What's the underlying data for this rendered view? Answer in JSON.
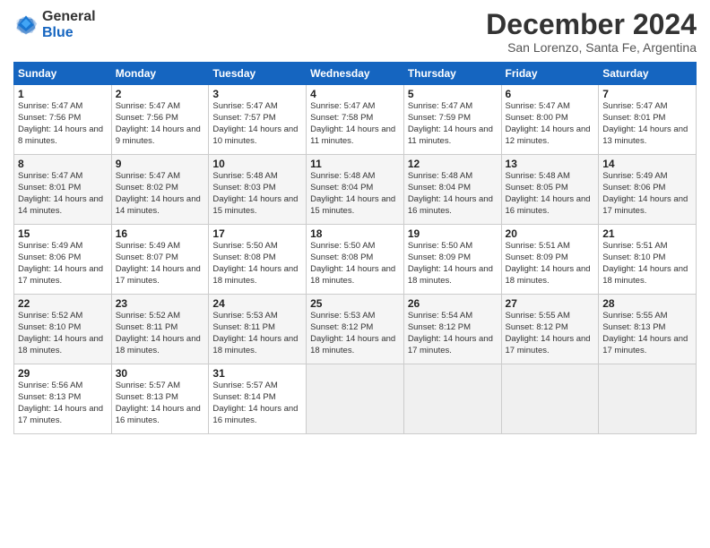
{
  "header": {
    "logo_general": "General",
    "logo_blue": "Blue",
    "month_title": "December 2024",
    "location": "San Lorenzo, Santa Fe, Argentina"
  },
  "days_of_week": [
    "Sunday",
    "Monday",
    "Tuesday",
    "Wednesday",
    "Thursday",
    "Friday",
    "Saturday"
  ],
  "weeks": [
    [
      {
        "day": 1,
        "sunrise": "5:47 AM",
        "sunset": "7:56 PM",
        "daylight": "14 hours and 8 minutes."
      },
      {
        "day": 2,
        "sunrise": "5:47 AM",
        "sunset": "7:56 PM",
        "daylight": "14 hours and 9 minutes."
      },
      {
        "day": 3,
        "sunrise": "5:47 AM",
        "sunset": "7:57 PM",
        "daylight": "14 hours and 10 minutes."
      },
      {
        "day": 4,
        "sunrise": "5:47 AM",
        "sunset": "7:58 PM",
        "daylight": "14 hours and 11 minutes."
      },
      {
        "day": 5,
        "sunrise": "5:47 AM",
        "sunset": "7:59 PM",
        "daylight": "14 hours and 11 minutes."
      },
      {
        "day": 6,
        "sunrise": "5:47 AM",
        "sunset": "8:00 PM",
        "daylight": "14 hours and 12 minutes."
      },
      {
        "day": 7,
        "sunrise": "5:47 AM",
        "sunset": "8:01 PM",
        "daylight": "14 hours and 13 minutes."
      }
    ],
    [
      {
        "day": 8,
        "sunrise": "5:47 AM",
        "sunset": "8:01 PM",
        "daylight": "14 hours and 14 minutes."
      },
      {
        "day": 9,
        "sunrise": "5:47 AM",
        "sunset": "8:02 PM",
        "daylight": "14 hours and 14 minutes."
      },
      {
        "day": 10,
        "sunrise": "5:48 AM",
        "sunset": "8:03 PM",
        "daylight": "14 hours and 15 minutes."
      },
      {
        "day": 11,
        "sunrise": "5:48 AM",
        "sunset": "8:04 PM",
        "daylight": "14 hours and 15 minutes."
      },
      {
        "day": 12,
        "sunrise": "5:48 AM",
        "sunset": "8:04 PM",
        "daylight": "14 hours and 16 minutes."
      },
      {
        "day": 13,
        "sunrise": "5:48 AM",
        "sunset": "8:05 PM",
        "daylight": "14 hours and 16 minutes."
      },
      {
        "day": 14,
        "sunrise": "5:49 AM",
        "sunset": "8:06 PM",
        "daylight": "14 hours and 17 minutes."
      }
    ],
    [
      {
        "day": 15,
        "sunrise": "5:49 AM",
        "sunset": "8:06 PM",
        "daylight": "14 hours and 17 minutes."
      },
      {
        "day": 16,
        "sunrise": "5:49 AM",
        "sunset": "8:07 PM",
        "daylight": "14 hours and 17 minutes."
      },
      {
        "day": 17,
        "sunrise": "5:50 AM",
        "sunset": "8:08 PM",
        "daylight": "14 hours and 18 minutes."
      },
      {
        "day": 18,
        "sunrise": "5:50 AM",
        "sunset": "8:08 PM",
        "daylight": "14 hours and 18 minutes."
      },
      {
        "day": 19,
        "sunrise": "5:50 AM",
        "sunset": "8:09 PM",
        "daylight": "14 hours and 18 minutes."
      },
      {
        "day": 20,
        "sunrise": "5:51 AM",
        "sunset": "8:09 PM",
        "daylight": "14 hours and 18 minutes."
      },
      {
        "day": 21,
        "sunrise": "5:51 AM",
        "sunset": "8:10 PM",
        "daylight": "14 hours and 18 minutes."
      }
    ],
    [
      {
        "day": 22,
        "sunrise": "5:52 AM",
        "sunset": "8:10 PM",
        "daylight": "14 hours and 18 minutes."
      },
      {
        "day": 23,
        "sunrise": "5:52 AM",
        "sunset": "8:11 PM",
        "daylight": "14 hours and 18 minutes."
      },
      {
        "day": 24,
        "sunrise": "5:53 AM",
        "sunset": "8:11 PM",
        "daylight": "14 hours and 18 minutes."
      },
      {
        "day": 25,
        "sunrise": "5:53 AM",
        "sunset": "8:12 PM",
        "daylight": "14 hours and 18 minutes."
      },
      {
        "day": 26,
        "sunrise": "5:54 AM",
        "sunset": "8:12 PM",
        "daylight": "14 hours and 17 minutes."
      },
      {
        "day": 27,
        "sunrise": "5:55 AM",
        "sunset": "8:12 PM",
        "daylight": "14 hours and 17 minutes."
      },
      {
        "day": 28,
        "sunrise": "5:55 AM",
        "sunset": "8:13 PM",
        "daylight": "14 hours and 17 minutes."
      }
    ],
    [
      {
        "day": 29,
        "sunrise": "5:56 AM",
        "sunset": "8:13 PM",
        "daylight": "14 hours and 17 minutes."
      },
      {
        "day": 30,
        "sunrise": "5:57 AM",
        "sunset": "8:13 PM",
        "daylight": "14 hours and 16 minutes."
      },
      {
        "day": 31,
        "sunrise": "5:57 AM",
        "sunset": "8:14 PM",
        "daylight": "14 hours and 16 minutes."
      },
      null,
      null,
      null,
      null
    ]
  ]
}
